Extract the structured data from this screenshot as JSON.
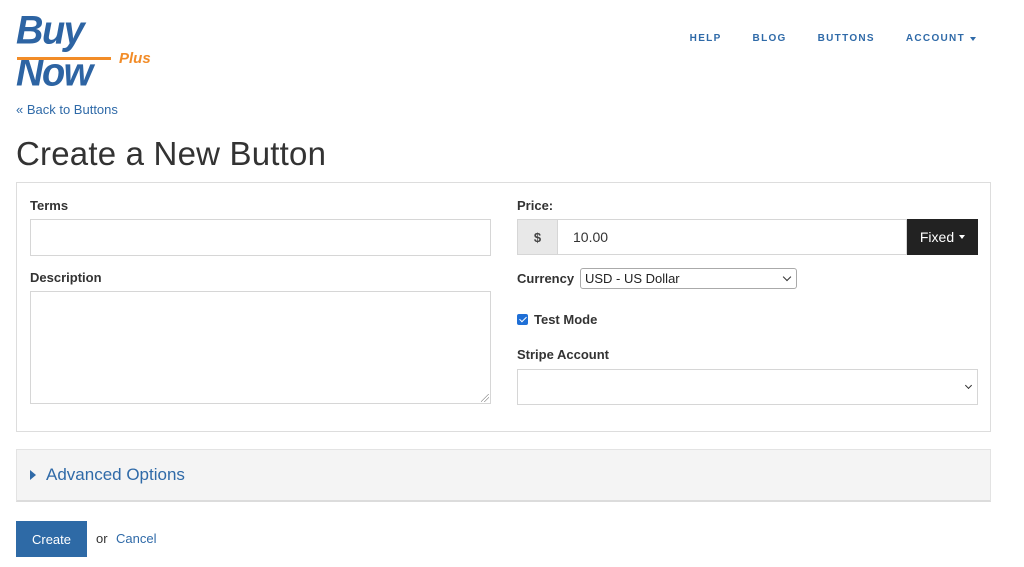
{
  "brand": {
    "logo_main": "Buy Now",
    "logo_sub": "Plus",
    "colors": {
      "primary": "#2d64a3",
      "accent": "#f28c28"
    }
  },
  "nav": {
    "items": [
      {
        "label": "HELP"
      },
      {
        "label": "BLOG"
      },
      {
        "label": "BUTTONS"
      },
      {
        "label": "ACCOUNT",
        "has_dropdown": true,
        "icon": "caret-down-icon"
      }
    ]
  },
  "back_link": "« Back to Buttons",
  "page_title": "Create a New Button",
  "form": {
    "terms": {
      "label": "Terms",
      "value": "",
      "placeholder": ""
    },
    "description": {
      "label": "Description",
      "value": "",
      "placeholder": ""
    },
    "price": {
      "label": "Price:",
      "currency_symbol": "$",
      "value": "10.00",
      "type_label": "Fixed"
    },
    "currency": {
      "label": "Currency",
      "selected": "USD - US Dollar"
    },
    "test_mode": {
      "label": "Test Mode",
      "checked": true
    },
    "stripe_account": {
      "label": "Stripe Account",
      "selected": ""
    }
  },
  "advanced_options": {
    "label": "Advanced Options",
    "expanded": false
  },
  "actions": {
    "create_label": "Create",
    "or_text": "or",
    "cancel_label": "Cancel"
  }
}
